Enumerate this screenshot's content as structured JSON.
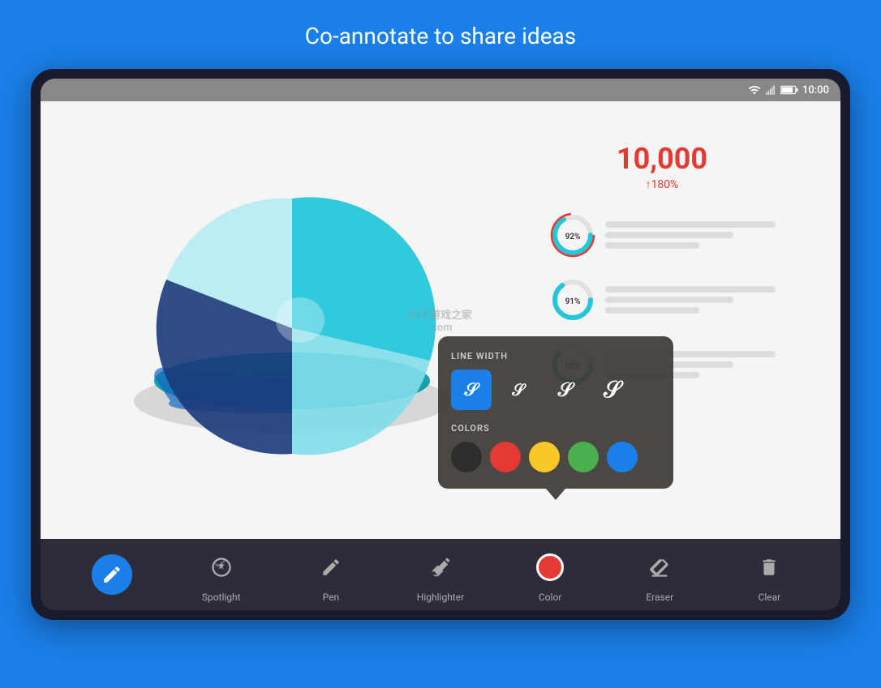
{
  "page": {
    "title": "Co-annotate to share ideas",
    "background_color": "#1a7fe8"
  },
  "status_bar": {
    "time": "10:00",
    "icons": [
      "wifi",
      "signal",
      "battery"
    ]
  },
  "chart": {
    "big_number": "10,000",
    "big_number_sub": "↑180%",
    "mini_stats": [
      {
        "percent": "92%",
        "color": "#26c6da"
      },
      {
        "percent": "91%",
        "color": "#26c6da"
      },
      {
        "percent": "85%",
        "color": "#26c6da"
      }
    ]
  },
  "popup": {
    "section_line_width": "LINE WIDTH",
    "section_colors": "COLORS",
    "line_widths": [
      {
        "id": "xs",
        "selected": true
      },
      {
        "id": "s",
        "selected": false
      },
      {
        "id": "m",
        "selected": false
      },
      {
        "id": "l",
        "selected": false
      }
    ],
    "colors": [
      {
        "id": "black",
        "hex": "#2d2d2d"
      },
      {
        "id": "red",
        "hex": "#e53935"
      },
      {
        "id": "yellow",
        "hex": "#f9c72a"
      },
      {
        "id": "green",
        "hex": "#4caf50"
      },
      {
        "id": "blue",
        "hex": "#1a7fe8"
      }
    ]
  },
  "toolbar": {
    "items": [
      {
        "id": "pen-active",
        "label": "Pen",
        "active": true
      },
      {
        "id": "spotlight",
        "label": "Spotlight",
        "active": false
      },
      {
        "id": "pen",
        "label": "Pen",
        "active": false
      },
      {
        "id": "highlighter",
        "label": "Highlighter",
        "active": false
      },
      {
        "id": "color",
        "label": "Color",
        "active": false
      },
      {
        "id": "eraser",
        "label": "Eraser",
        "active": false
      },
      {
        "id": "clear",
        "label": "Clear",
        "active": false
      }
    ]
  },
  "watermark": {
    "text": "K73 游戏之家\n.com"
  }
}
